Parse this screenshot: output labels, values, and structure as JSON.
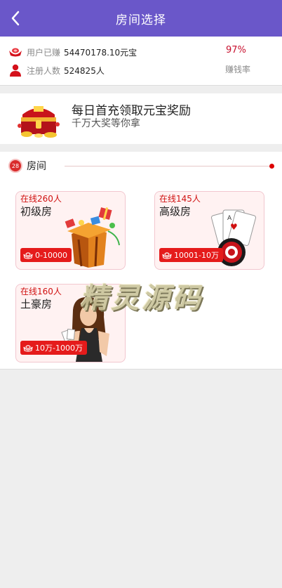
{
  "header": {
    "title": "房间选择",
    "back_icon": "chevron-left-icon"
  },
  "stats": {
    "earned_label": "用户已赚",
    "earned_value": "54470178.10元宝",
    "users_label": "注册人数",
    "users_value": "524825人",
    "rate_value": "97%",
    "rate_label": "赚钱率"
  },
  "promo": {
    "title": "每日首充领取元宝奖励",
    "subtitle": "千万大奖等你拿",
    "icon": "treasure-chest-icon"
  },
  "rooms_section": {
    "badge": "28",
    "label": "房间",
    "rooms": [
      {
        "online": "在线260人",
        "name": "初级房",
        "range": "0-10000",
        "art": "gift-box"
      },
      {
        "online": "在线145人",
        "name": "高级房",
        "range": "10001-10万",
        "art": "playing-cards-chip"
      },
      {
        "online": "在线160人",
        "name": "土豪房",
        "range": "10万-1000万",
        "art": "card-dealer-woman"
      }
    ]
  },
  "watermark": "精灵源码",
  "colors": {
    "header": "#6a57c9",
    "accent": "#e51b1b",
    "rate": "#c8102e",
    "card_bg": "#fff2f2"
  }
}
